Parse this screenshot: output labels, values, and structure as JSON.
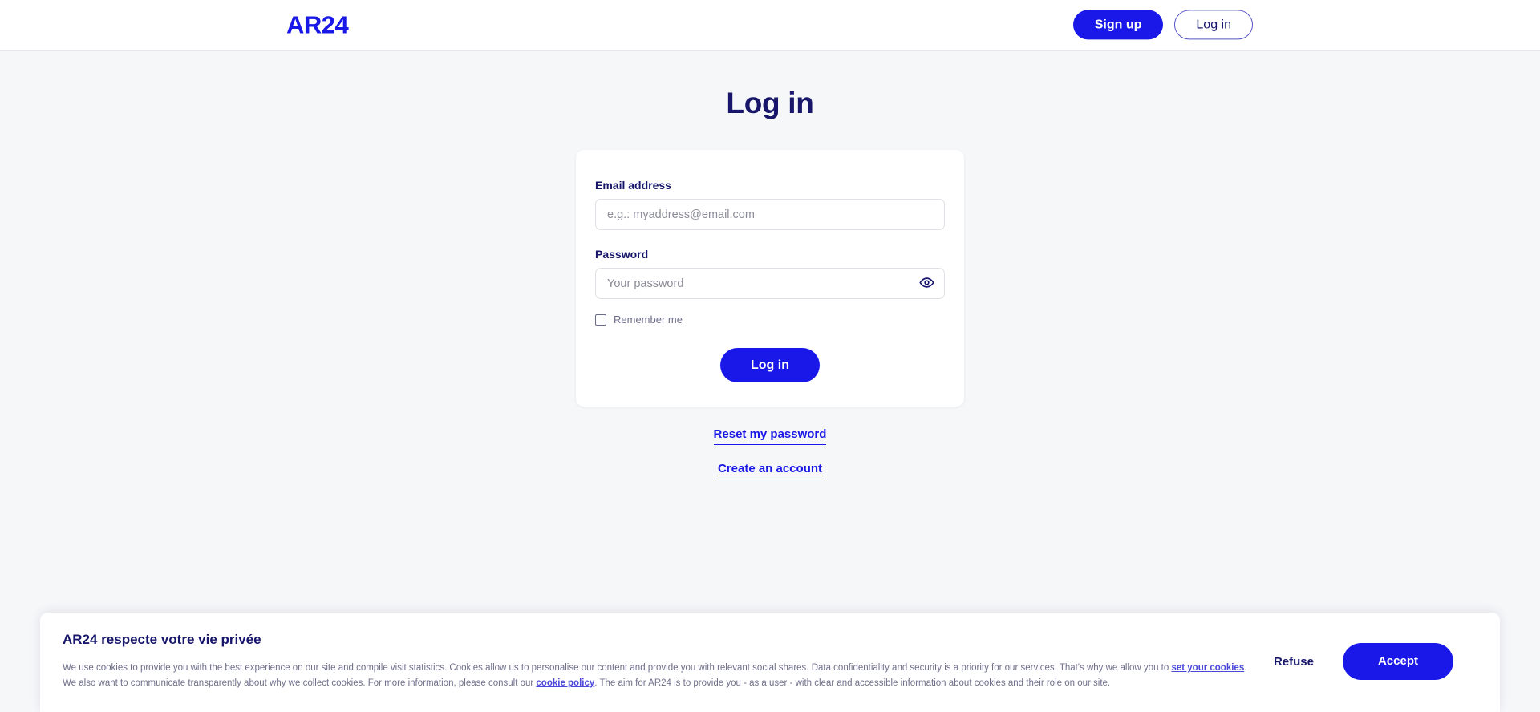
{
  "header": {
    "logo_text": "AR24",
    "signup_label": "Sign up",
    "login_label": "Log in"
  },
  "main": {
    "page_title": "Log in",
    "form": {
      "email_label": "Email address",
      "email_value": "",
      "email_placeholder": "e.g.: myaddress@email.com",
      "password_label": "Password",
      "password_value": "",
      "password_placeholder": "Your password",
      "toggle_password_icon": "eye-icon",
      "remember_label": "Remember me",
      "remember_checked": false,
      "submit_label": "Log in"
    },
    "links": {
      "reset_password": "Reset my password",
      "create_account": "Create an account"
    }
  },
  "cookie_banner": {
    "title": "AR24 respecte votre vie privée",
    "paragraph1_part1": "We use cookies to provide you with the best experience on our site and compile visit statistics. Cookies allow us to personalise our content and provide you with relevant social shares. Data confidentiality and security is a priority for our services. That's why we allow you to ",
    "paragraph1_link": "set your cookies",
    "paragraph1_part2": ".",
    "paragraph2_part1": "We also want to communicate transparently about why we collect cookies. For more information, please consult our ",
    "paragraph2_link": "cookie policy",
    "paragraph2_part2": ". The aim for AR24 is to provide you - as a user - with clear and accessible information about cookies and their role on our site.",
    "refuse_label": "Refuse",
    "accept_label": "Accept"
  },
  "colors": {
    "brand_blue": "#1a18e8",
    "navy": "#17166b",
    "page_bg": "#f6f7f9",
    "card_bg": "#ffffff",
    "muted_text": "#6f6f8c",
    "input_border": "#dfe1e6"
  }
}
